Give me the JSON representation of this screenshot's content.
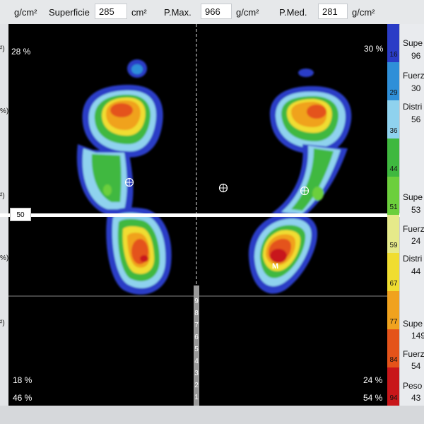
{
  "header": {
    "unit_left": "g/cm²",
    "superficie_label": "Superficie",
    "superficie_value": "285",
    "superficie_unit": "cm²",
    "pmax_label": "P.Max.",
    "pmax_value": "966",
    "pmax_unit": "g/cm²",
    "pmed_label": "P.Med.",
    "pmed_value": "281",
    "pmed_unit": "g/cm²"
  },
  "left_strip_ticks": [
    "²)",
    "%)",
    "²)",
    "%)",
    "²)"
  ],
  "plot": {
    "top_left_pct": "28 %",
    "top_right_pct": "30 %",
    "bottom_left_pct_1": "18 %",
    "bottom_left_pct_2": "46 %",
    "bottom_right_pct_1": "24 %",
    "bottom_right_pct_2": "54 %",
    "divider_label": "50",
    "marker_label": "M",
    "ruler_digits": [
      "9",
      "8",
      "7",
      "6",
      "5",
      "4",
      "3",
      "2",
      "1"
    ]
  },
  "scale": {
    "ticks": [
      "16",
      "29",
      "36",
      "44",
      "51",
      "59",
      "67",
      "77",
      "84",
      "94"
    ],
    "colors": [
      "#2a3cc6",
      "#2f8fd8",
      "#8fd2ee",
      "#3fb83f",
      "#6ccf3c",
      "#e6ea8a",
      "#f0dd30",
      "#f0a21e",
      "#e4531a",
      "#c8161a"
    ]
  },
  "right_panel": {
    "items": [
      {
        "label": "Supe",
        "value": "96"
      },
      {
        "label": "Fuerz",
        "value": "30"
      },
      {
        "label": "Distri",
        "value": "56"
      },
      {
        "label": "Supe",
        "value": "53"
      },
      {
        "label": "Fuerz",
        "value": "24"
      },
      {
        "label": "Distri",
        "value": "44"
      },
      {
        "label": "Supe",
        "value": "149"
      },
      {
        "label": "Fuerz",
        "value": "54"
      },
      {
        "label": "Peso",
        "value": "43"
      }
    ]
  }
}
